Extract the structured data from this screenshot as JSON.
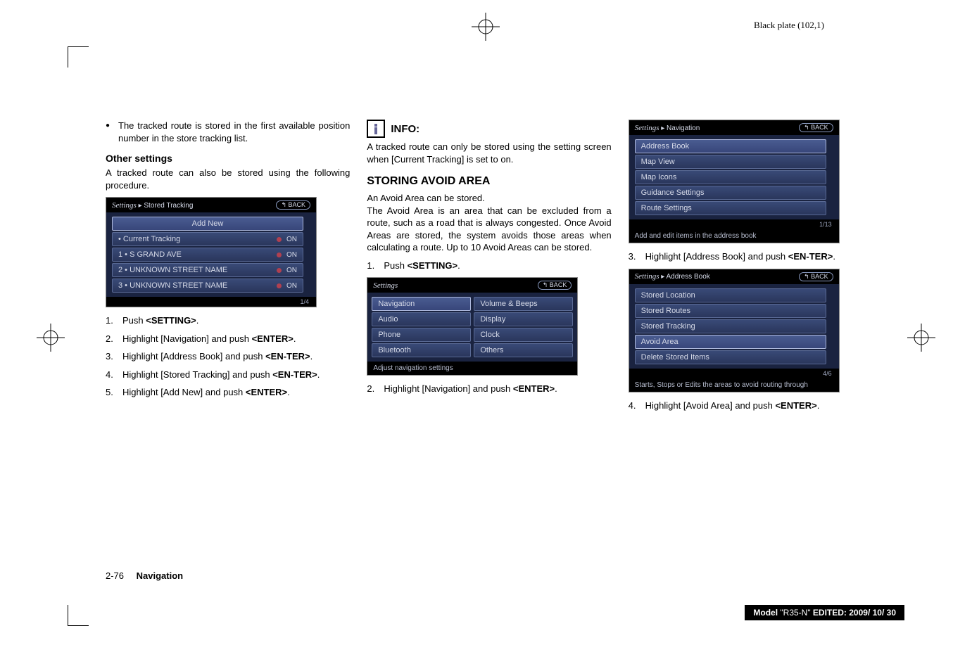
{
  "header": {
    "plate": "Black plate (102,1)"
  },
  "col1": {
    "bullet": "The tracked route is stored in the first available position number in the store tracking list.",
    "otherSettingsHeading": "Other settings",
    "otherSettingsText": "A tracked route can also be stored using the following procedure.",
    "screenshot": {
      "breadcrumb": "Settings ▸ Stored Tracking",
      "back": "↰ BACK",
      "addNew": "Add New",
      "rows": [
        {
          "label": "• Current Tracking",
          "state": "ON"
        },
        {
          "label": "1 • S GRAND AVE",
          "state": "ON"
        },
        {
          "label": "2 • UNKNOWN STREET NAME",
          "state": "ON"
        },
        {
          "label": "3 • UNKNOWN STREET NAME",
          "state": "ON"
        }
      ],
      "pager": "1/4"
    },
    "steps": [
      "Push <SETTING>.",
      "Highlight [Navigation] and push <ENTER>.",
      "Highlight [Address Book] and push <EN-TER>.",
      "Highlight [Stored Tracking] and push <EN-TER>.",
      "Highlight [Add New] and push <ENTER>."
    ]
  },
  "col2": {
    "infoLabel": "INFO:",
    "infoText": "A tracked route can only be stored using the setting screen when [Current Tracking] is set to on.",
    "sectionHeading": "STORING AVOID AREA",
    "sectionText1": "An Avoid Area can be stored.",
    "sectionText2": "The Avoid Area is an area that can be excluded from a route, such as a road that is always congested. Once Avoid Areas are stored, the system avoids those areas when calculating a route. Up to 10 Avoid Areas can be stored.",
    "step1": "Push <SETTING>.",
    "screenshot": {
      "title": "Settings",
      "back": "↰ BACK",
      "left": [
        "Navigation",
        "Audio",
        "Phone",
        "Bluetooth"
      ],
      "right": [
        "Volume & Beeps",
        "Display",
        "Clock",
        "Others"
      ],
      "footer": "Adjust navigation settings"
    },
    "step2": "Highlight [Navigation] and push <ENTER>."
  },
  "col3": {
    "screenshot1": {
      "breadcrumb": "Settings ▸ Navigation",
      "back": "↰ BACK",
      "rows": [
        "Address Book",
        "Map View",
        "Map Icons",
        "Guidance Settings",
        "Route Settings"
      ],
      "pager": "1/13",
      "footer": "Add and edit items in the address book"
    },
    "step3": "Highlight [Address Book] and push <EN-TER>.",
    "screenshot2": {
      "breadcrumb": "Settings ▸ Address Book",
      "back": "↰ BACK",
      "rows": [
        "Stored Location",
        "Stored Routes",
        "Stored Tracking",
        "Avoid Area",
        "Delete Stored Items"
      ],
      "pager": "4/6",
      "footer": "Starts, Stops or Edits the areas to avoid routing through"
    },
    "step4": "Highlight [Avoid Area] and push <ENTER>."
  },
  "footer": {
    "pageNum": "2-76",
    "section": "Navigation"
  },
  "modelbar": {
    "prefix": "Model ",
    "model": "\"R35-N\"",
    "edited": "   EDITED:  2009/ 10/ 30"
  }
}
